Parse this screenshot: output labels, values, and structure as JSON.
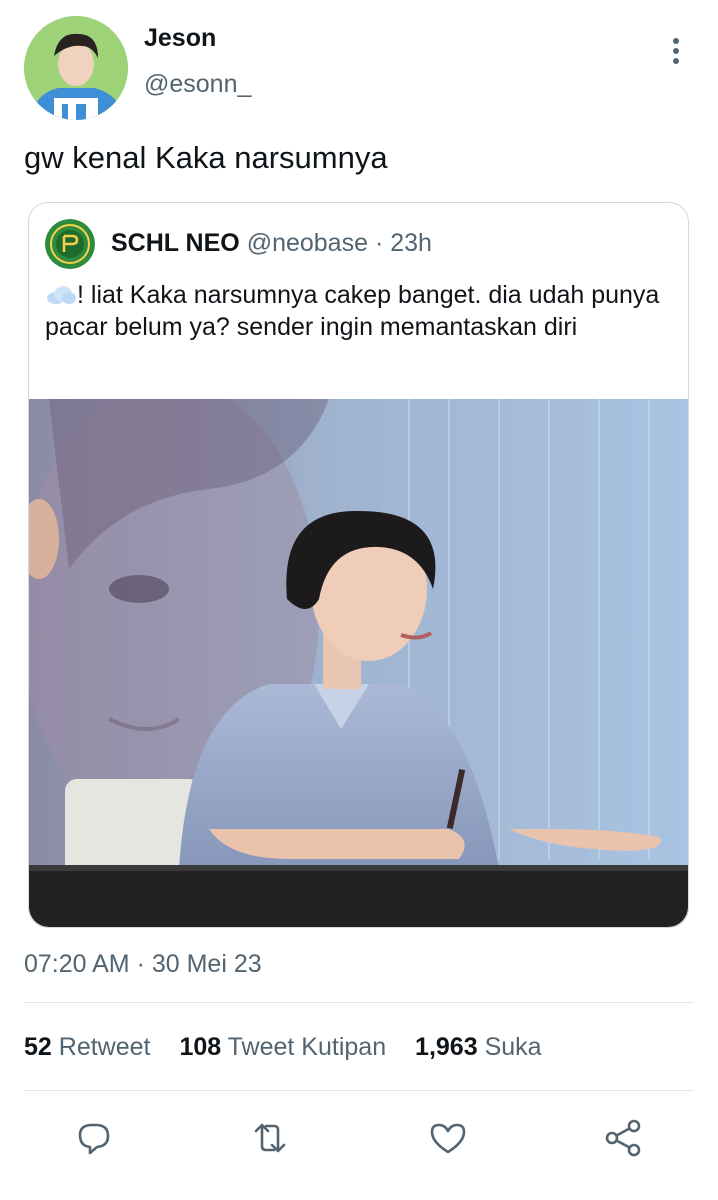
{
  "tweet": {
    "author": {
      "display_name": "Jeson",
      "handle": "@esonn_"
    },
    "text": "gw kenal Kaka narsumnya",
    "timestamp": "07:20 AM · 30 Mei 23",
    "quote": {
      "author": {
        "display_name": "SCHL NEO",
        "handle": "@neobase"
      },
      "separator": "·",
      "time": "23h",
      "text": "! liat Kaka narsumnya cakep banget. dia udah punya pacar belum ya? sender ingin memantaskan diri",
      "media_alt": "photo"
    }
  },
  "stats": [
    {
      "count": "52",
      "label": "Retweet"
    },
    {
      "count": "108",
      "label": "Tweet Kutipan"
    },
    {
      "count": "1,963",
      "label": "Suka"
    }
  ],
  "icons": {
    "more": "more-vertical-icon",
    "reply": "reply-icon",
    "retweet": "retweet-icon",
    "like": "heart-icon",
    "share": "share-icon",
    "emoji": "cloud-icon"
  },
  "colors": {
    "text": "#0f1419",
    "secondary": "#536471",
    "border": "#cfd9de",
    "avatar_bg": "#9ed37a",
    "quote_logo": "#2e8b3e"
  }
}
